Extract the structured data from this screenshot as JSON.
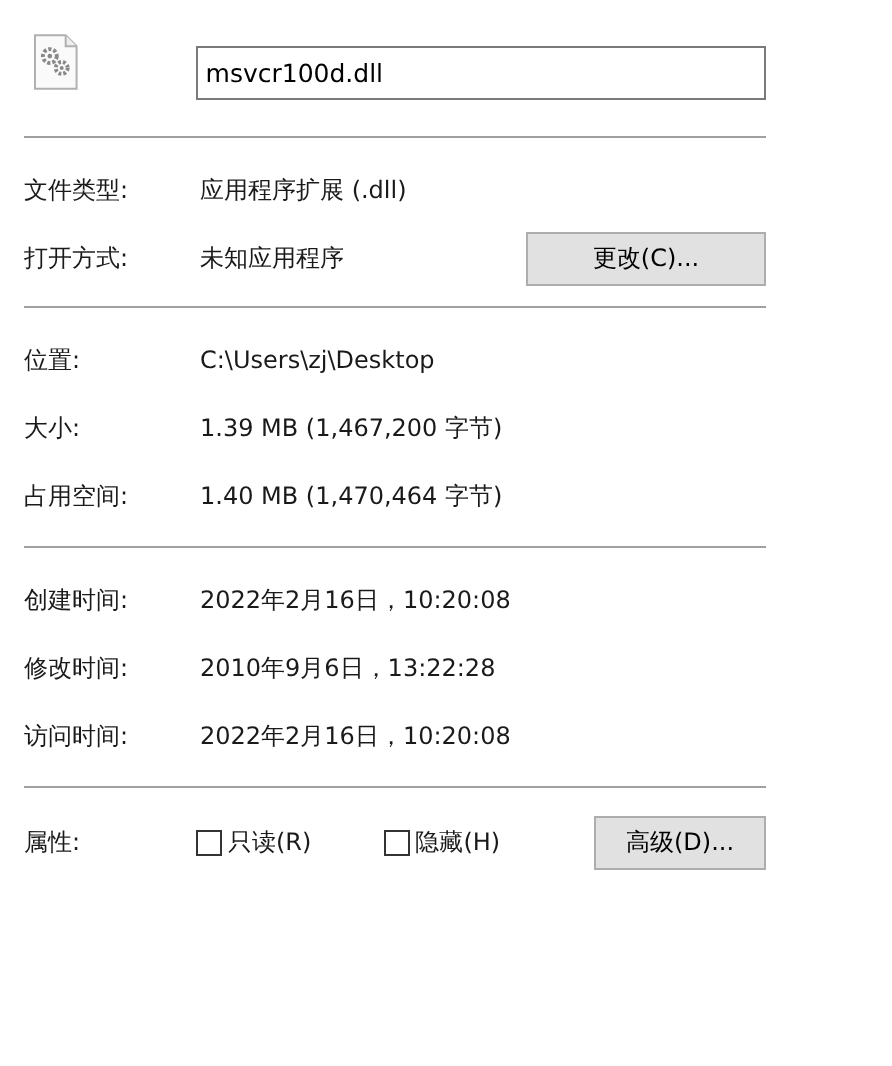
{
  "file": {
    "name": "msvcr100d.dll"
  },
  "sections": [
    {
      "rows": [
        {
          "label": "文件类型:",
          "value": "应用程序扩展 (.dll)"
        },
        {
          "label": "打开方式:",
          "value": "未知应用程序",
          "button": "更改(C)..."
        }
      ]
    },
    {
      "rows": [
        {
          "label": "位置:",
          "value": "C:\\Users\\zj\\Desktop"
        },
        {
          "label": "大小:",
          "value": "1.39 MB (1,467,200 字节)"
        },
        {
          "label": "占用空间:",
          "value": "1.40 MB (1,470,464 字节)"
        }
      ]
    },
    {
      "rows": [
        {
          "label": "创建时间:",
          "value": "2022年2月16日，10:20:08"
        },
        {
          "label": "修改时间:",
          "value": "2010年9月6日，13:22:28"
        },
        {
          "label": "访问时间:",
          "value": "2022年2月16日，10:20:08"
        }
      ]
    }
  ],
  "attributes": {
    "label": "属性:",
    "checkboxes": [
      {
        "label": "只读(R)",
        "checked": false
      },
      {
        "label": "隐藏(H)",
        "checked": false
      }
    ],
    "button": "高级(D)..."
  }
}
